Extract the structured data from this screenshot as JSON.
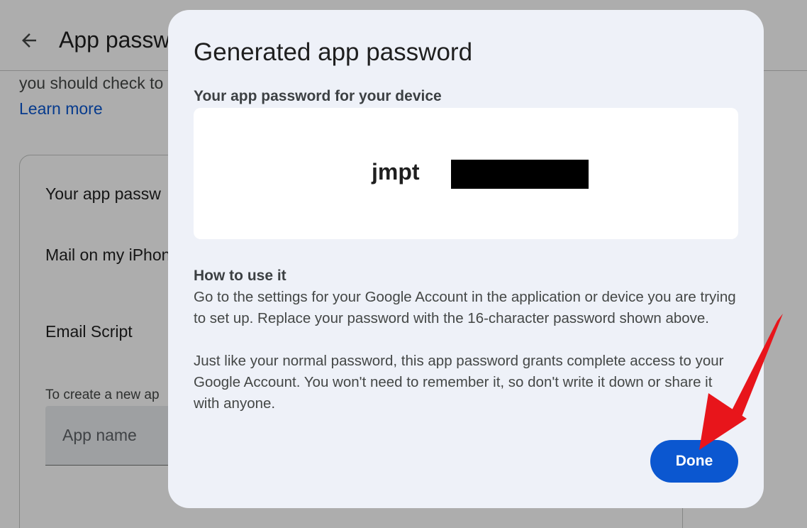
{
  "background_page": {
    "title": "App passw",
    "intro_text": "you should check to",
    "learn_more": "Learn more",
    "card_title": "Your app passw",
    "apps": [
      "Mail on my iPhon",
      "Email Script"
    ],
    "create_hint": "To create a new ap",
    "app_name_placeholder": "App name"
  },
  "dialog": {
    "title": "Generated app password",
    "subtitle": "Your app password for your device",
    "password_visible": "jmpt",
    "password_redacted": true,
    "how_to_title": "How to use it",
    "how_to_paragraphs": [
      "Go to the settings for your Google Account in the application or device you are trying to set up. Replace your password with the 16-character password shown above.",
      "Just like your normal password, this app password grants complete access to your Google Account. You won't need to remember it, so don't write it down or share it with anyone."
    ],
    "done_label": "Done"
  },
  "icons": {
    "back": "arrow-back-icon"
  },
  "annotation": {
    "type": "red-arrow",
    "points_to": "done-button",
    "color": "#e8151b"
  },
  "colors": {
    "primary": "#0b57d0",
    "dialog_background": "#eef1f8",
    "scrim": "rgba(0,0,0,0.32)"
  }
}
